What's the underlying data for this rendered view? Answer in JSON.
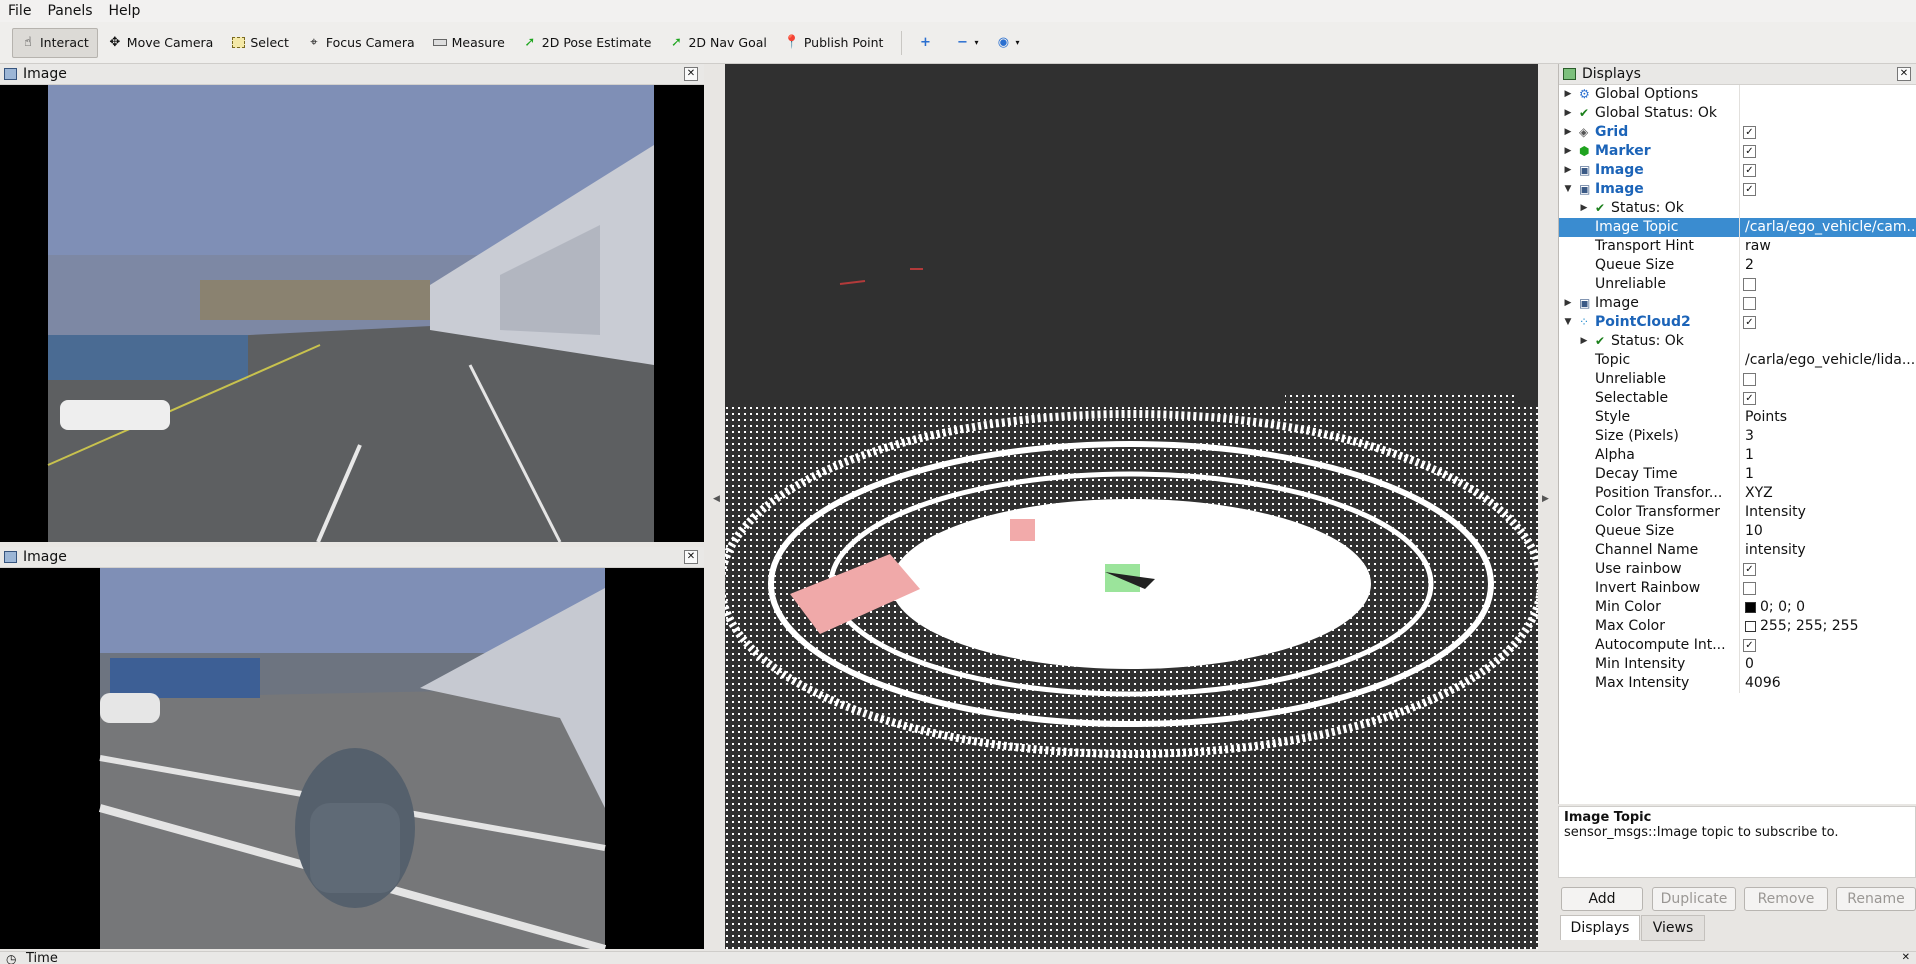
{
  "menubar": {
    "items": [
      "File",
      "Panels",
      "Help"
    ]
  },
  "toolbar": {
    "tools": [
      {
        "label": "Interact",
        "icon": "hand-pointer-icon",
        "active": true
      },
      {
        "label": "Move Camera",
        "icon": "move-arrows-icon"
      },
      {
        "label": "Select",
        "icon": "select-box-icon"
      },
      {
        "label": "Focus Camera",
        "icon": "crosshair-icon"
      },
      {
        "label": "Measure",
        "icon": "ruler-icon"
      },
      {
        "label": "2D Pose Estimate",
        "icon": "green-arrow-icon"
      },
      {
        "label": "2D Nav Goal",
        "icon": "green-arrow-icon"
      },
      {
        "label": "Publish Point",
        "icon": "map-pin-icon"
      }
    ],
    "extra_icons": [
      "plus-icon",
      "minus-icon",
      "eye-icon"
    ]
  },
  "image_panel_top": {
    "title": "Image"
  },
  "image_panel_bottom": {
    "title": "Image"
  },
  "displays": {
    "title": "Displays",
    "rows": [
      {
        "level": 0,
        "arrow": "right",
        "icon": "gear-icon",
        "label": "Global Options",
        "value": ""
      },
      {
        "level": 0,
        "arrow": "right",
        "icon": "check-icon",
        "label": "Global Status: Ok",
        "value": ""
      },
      {
        "level": 0,
        "arrow": "right",
        "icon": "grid-icon",
        "label": "Grid",
        "blue": true,
        "checked": true
      },
      {
        "level": 0,
        "arrow": "right",
        "icon": "cube-icon",
        "label": "Marker",
        "blue": true,
        "checked": true
      },
      {
        "level": 0,
        "arrow": "right",
        "icon": "image-icon",
        "label": "Image",
        "blue": true,
        "checked": true
      },
      {
        "level": 0,
        "arrow": "down",
        "icon": "image-icon",
        "label": "Image",
        "blue": true,
        "checked": true
      },
      {
        "level": 1,
        "arrow": "right",
        "icon": "check-icon",
        "label": "Status: Ok",
        "value": ""
      },
      {
        "level": 1,
        "arrow": "",
        "icon": "",
        "label": "Image Topic",
        "value": "/carla/ego_vehicle/cam...",
        "selected": true
      },
      {
        "level": 1,
        "arrow": "",
        "icon": "",
        "label": "Transport Hint",
        "value": "raw"
      },
      {
        "level": 1,
        "arrow": "",
        "icon": "",
        "label": "Queue Size",
        "value": "2"
      },
      {
        "level": 1,
        "arrow": "",
        "icon": "",
        "label": "Unreliable",
        "checked": false
      },
      {
        "level": 0,
        "arrow": "right",
        "icon": "image-icon",
        "label": "Image",
        "checked": false
      },
      {
        "level": 0,
        "arrow": "down",
        "icon": "pointcloud-icon",
        "label": "PointCloud2",
        "blue": true,
        "checked": true
      },
      {
        "level": 1,
        "arrow": "right",
        "icon": "check-icon",
        "label": "Status: Ok",
        "value": ""
      },
      {
        "level": 1,
        "arrow": "",
        "icon": "",
        "label": "Topic",
        "value": "/carla/ego_vehicle/lida..."
      },
      {
        "level": 1,
        "arrow": "",
        "icon": "",
        "label": "Unreliable",
        "checked": false
      },
      {
        "level": 1,
        "arrow": "",
        "icon": "",
        "label": "Selectable",
        "checked": true
      },
      {
        "level": 1,
        "arrow": "",
        "icon": "",
        "label": "Style",
        "value": "Points"
      },
      {
        "level": 1,
        "arrow": "",
        "icon": "",
        "label": "Size (Pixels)",
        "value": "3"
      },
      {
        "level": 1,
        "arrow": "",
        "icon": "",
        "label": "Alpha",
        "value": "1"
      },
      {
        "level": 1,
        "arrow": "",
        "icon": "",
        "label": "Decay Time",
        "value": "1"
      },
      {
        "level": 1,
        "arrow": "",
        "icon": "",
        "label": "Position Transfor...",
        "value": "XYZ"
      },
      {
        "level": 1,
        "arrow": "",
        "icon": "",
        "label": "Color Transformer",
        "value": "Intensity"
      },
      {
        "level": 1,
        "arrow": "",
        "icon": "",
        "label": "Queue Size",
        "value": "10"
      },
      {
        "level": 1,
        "arrow": "",
        "icon": "",
        "label": "Channel Name",
        "value": "intensity"
      },
      {
        "level": 1,
        "arrow": "",
        "icon": "",
        "label": "Use rainbow",
        "checked": true
      },
      {
        "level": 1,
        "arrow": "",
        "icon": "",
        "label": "Invert Rainbow",
        "checked": false
      },
      {
        "level": 1,
        "arrow": "",
        "icon": "",
        "label": "Min Color",
        "value": "0; 0; 0",
        "swatch": "#000000"
      },
      {
        "level": 1,
        "arrow": "",
        "icon": "",
        "label": "Max Color",
        "value": "255; 255; 255",
        "swatch": "#ffffff"
      },
      {
        "level": 1,
        "arrow": "",
        "icon": "",
        "label": "Autocompute Int...",
        "checked": true
      },
      {
        "level": 1,
        "arrow": "",
        "icon": "",
        "label": "Min Intensity",
        "value": "0"
      },
      {
        "level": 1,
        "arrow": "",
        "icon": "",
        "label": "Max Intensity",
        "value": "4096"
      }
    ]
  },
  "description": {
    "title": "Image Topic",
    "text": "sensor_msgs::Image topic to subscribe to."
  },
  "buttons": {
    "add": "Add",
    "duplicate": "Duplicate",
    "remove": "Remove",
    "rename": "Rename"
  },
  "tabs": {
    "displays": "Displays",
    "views": "Views"
  },
  "bottom_panel": {
    "title": "Time"
  },
  "colors": {
    "accent_selected": "#3a8cd0",
    "viewport_bg": "#303030",
    "display_blue": "#1c64b8"
  }
}
